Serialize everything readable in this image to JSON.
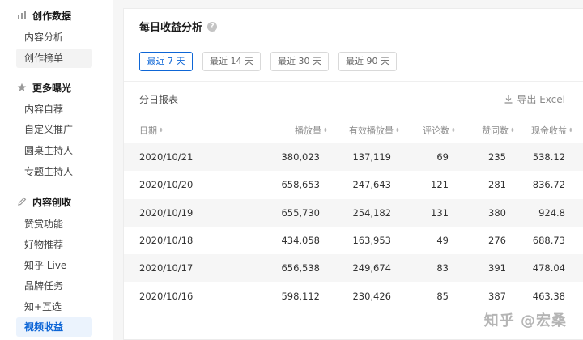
{
  "sidebar": {
    "sections": [
      {
        "title": "创作数据",
        "icon": "bar-chart-icon",
        "items": [
          "内容分析",
          "创作榜单"
        ]
      },
      {
        "title": "更多曝光",
        "icon": "star-icon",
        "items": [
          "内容自荐",
          "自定义推广",
          "圆桌主持人",
          "专题主持人"
        ]
      },
      {
        "title": "内容创收",
        "icon": "pen-icon",
        "items": [
          "赞赏功能",
          "好物推荐",
          "知乎 Live",
          "品牌任务",
          "知+互选",
          "视频收益"
        ]
      }
    ],
    "active_item": "视频收益"
  },
  "card": {
    "title": "每日收益分析",
    "help_symbol": "?",
    "ranges": [
      "最近 7 天",
      "最近 14 天",
      "最近 30 天",
      "最近 90 天"
    ],
    "active_range": "最近 7 天",
    "report_title": "分日报表",
    "export_label": "导出 Excel"
  },
  "table": {
    "columns": [
      "日期",
      "播放量",
      "有效播放量",
      "评论数",
      "赞同数",
      "现金收益"
    ],
    "sort_symbol": "⬍",
    "rows": [
      [
        "2020/10/21",
        "380,023",
        "137,119",
        "69",
        "235",
        "538.12"
      ],
      [
        "2020/10/20",
        "658,653",
        "247,643",
        "121",
        "281",
        "836.72"
      ],
      [
        "2020/10/19",
        "655,730",
        "254,182",
        "131",
        "380",
        "924.8"
      ],
      [
        "2020/10/18",
        "434,058",
        "163,953",
        "49",
        "276",
        "688.73"
      ],
      [
        "2020/10/17",
        "656,538",
        "249,674",
        "83",
        "391",
        "478.04"
      ],
      [
        "2020/10/16",
        "598,112",
        "230,426",
        "85",
        "387",
        "463.38"
      ]
    ]
  },
  "watermark": "知乎 @宏桑",
  "colors": {
    "accent": "#0e66d6",
    "row_shade": "#f6f6f6"
  }
}
